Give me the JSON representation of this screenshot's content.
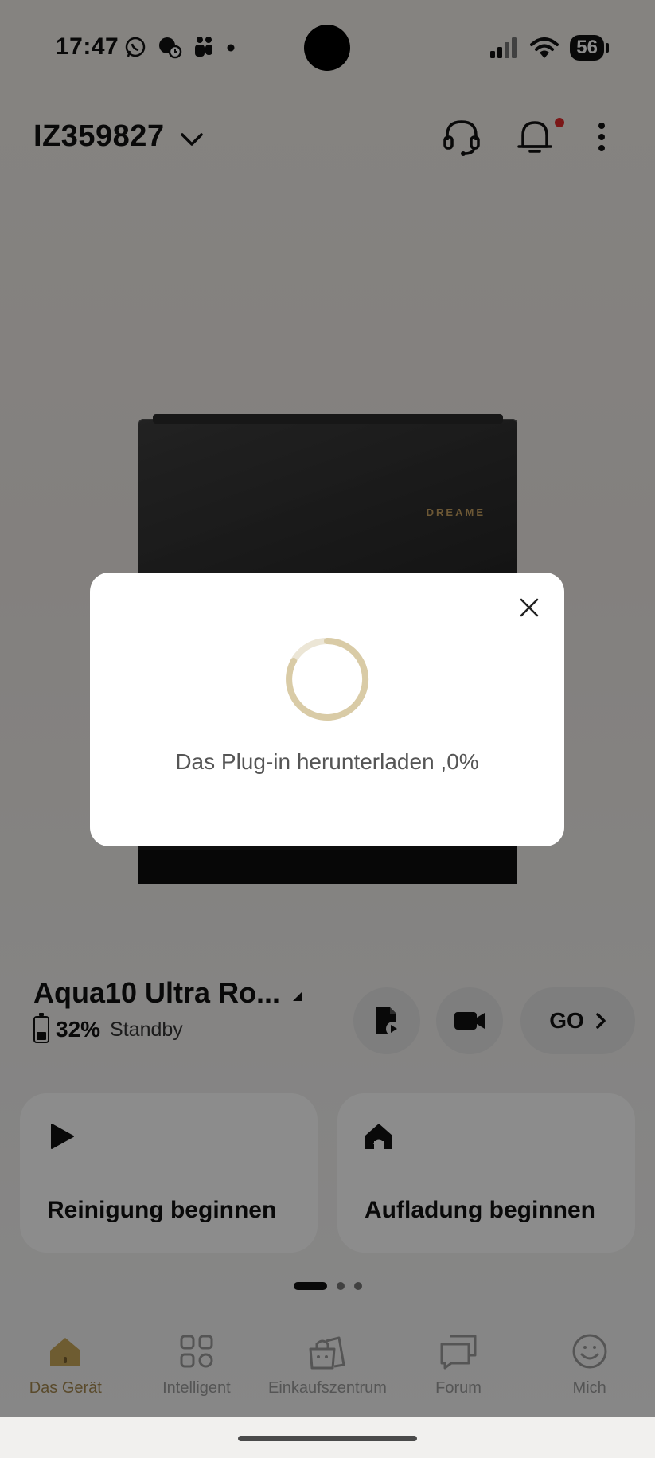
{
  "status_bar": {
    "time": "17:47",
    "battery": "56",
    "left_icons": [
      "whatsapp-icon",
      "app-notification-icon",
      "teams-icon",
      "more-dot-icon"
    ],
    "right_icons": [
      "signal-icon",
      "wifi-icon",
      "battery-icon"
    ]
  },
  "header": {
    "device_id": "IZ359827",
    "icons": [
      "support-headset-icon",
      "bell-icon",
      "more-vertical-icon"
    ],
    "notification_dot_color": "#e12a2a"
  },
  "product": {
    "brand_logo": "DREAME"
  },
  "robot": {
    "name": "Aqua10 Ultra Ro...",
    "battery_percent": "32%",
    "battery_level": 0.32,
    "status": "Standby"
  },
  "quick_buttons": {
    "go_label": "GO"
  },
  "actions": [
    {
      "label": "Reinigung beginnen",
      "icon": "play-icon"
    },
    {
      "label": "Aufladung beginnen",
      "icon": "home-dock-icon"
    }
  ],
  "pager": {
    "count": 3,
    "active": 0
  },
  "tabbar": {
    "items": [
      {
        "label": "Das Gerät",
        "icon": "house-icon",
        "active": true
      },
      {
        "label": "Intelligent",
        "icon": "grid-icon",
        "active": false
      },
      {
        "label": "Einkaufszentrum",
        "icon": "shopping-bag-icon",
        "active": false
      },
      {
        "label": "Forum",
        "icon": "chat-bubbles-icon",
        "active": false
      },
      {
        "label": "Mich",
        "icon": "smiley-icon",
        "active": false
      }
    ]
  },
  "dialog": {
    "message": "Das Plug-in herunterladen ,0%",
    "progress": 0
  },
  "colors": {
    "accent": "#a4884f",
    "overlay": "rgba(0,0,0,0.45)"
  }
}
